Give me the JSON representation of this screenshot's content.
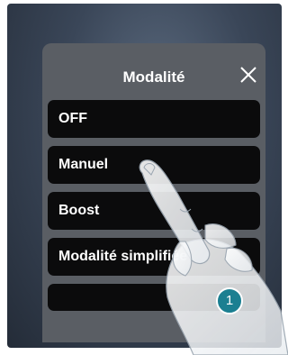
{
  "dialog": {
    "title": "Modalité",
    "close_icon": "close-icon"
  },
  "options": [
    {
      "label": "OFF"
    },
    {
      "label": "Manuel"
    },
    {
      "label": "Boost"
    },
    {
      "label": "Modalité simplifiée"
    },
    {
      "label": ""
    }
  ],
  "step_badge": "1",
  "colors": {
    "dialog_bg": "#5a5e64",
    "option_bg": "#0b0b0c",
    "badge": "#1b7f91"
  }
}
